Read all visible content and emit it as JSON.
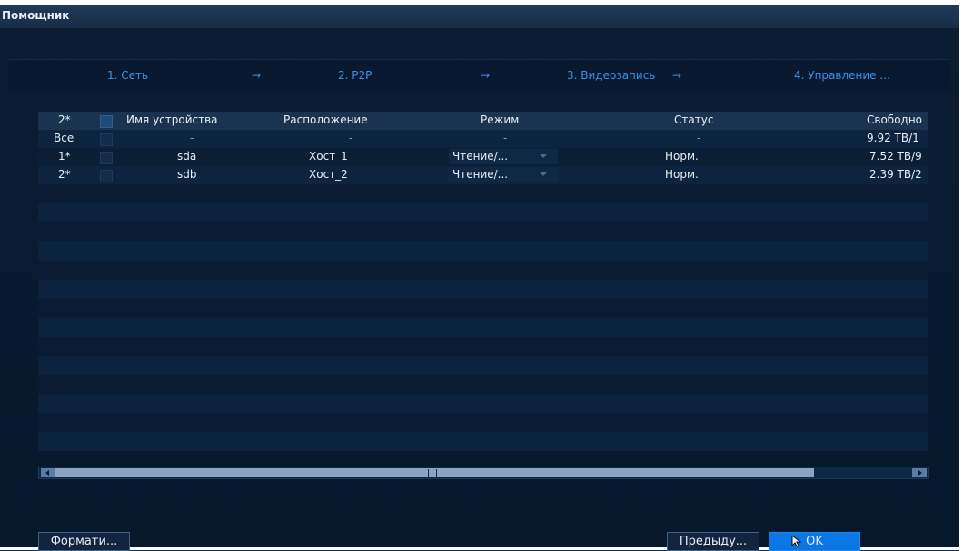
{
  "window": {
    "title": "Помощник"
  },
  "steps": [
    {
      "label": "1. Сеть"
    },
    {
      "label": "2. P2P"
    },
    {
      "label": "3. Видеозапись"
    },
    {
      "label": "4. Управление ..."
    }
  ],
  "step_arrow": "→",
  "table": {
    "columns": {
      "number": "2*",
      "device_name": "Имя устройства",
      "location": "Расположение",
      "mode": "Режим",
      "status": "Статус",
      "free": "Свободно"
    },
    "rows": [
      {
        "number": "Все",
        "device_name": "-",
        "location": "-",
        "mode": "-",
        "status": "-",
        "free": "9.92 TB/1"
      },
      {
        "number": "1*",
        "device_name": "sda",
        "location": "Хост_1",
        "mode": "Чтение/...",
        "status": "Норм.",
        "free": "7.52 TB/9"
      },
      {
        "number": "2*",
        "device_name": "sdb",
        "location": "Хост_2",
        "mode": "Чтение/...",
        "status": "Норм.",
        "free": "2.39 TB/2"
      }
    ]
  },
  "buttons": {
    "format": "Формати...",
    "previous": "Предыду...",
    "ok": "OK"
  },
  "colors": {
    "accent": "#0b77e4",
    "step_text": "#3d8fe6",
    "background": "#061628"
  }
}
